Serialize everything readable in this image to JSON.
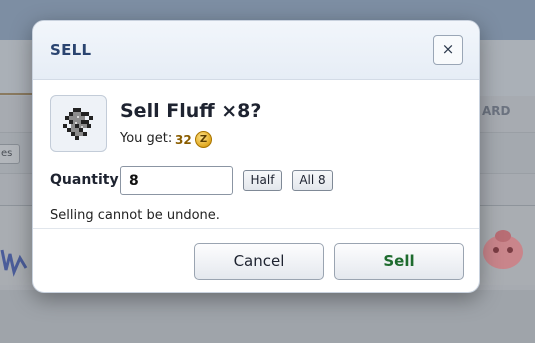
{
  "background": {
    "left_chip_label": "es",
    "right_tab_label": "ARD"
  },
  "modal": {
    "title": "SELL",
    "close_label": "×",
    "item": {
      "icon": "fluff-icon",
      "heading": "Sell Fluff ×8?",
      "you_get_label": "You get:",
      "price": "32",
      "currency_icon_label": "Z"
    },
    "quantity": {
      "label": "Quantity",
      "value": "8",
      "half_label": "Half",
      "all_label": "All 8"
    },
    "warning": "Selling cannot be undone.",
    "buttons": {
      "cancel_label": "Cancel",
      "sell_label": "Sell"
    },
    "colors": {
      "title": "#2a4470",
      "price": "#8a5d00",
      "sell_button_text": "#1e6b2e"
    }
  }
}
